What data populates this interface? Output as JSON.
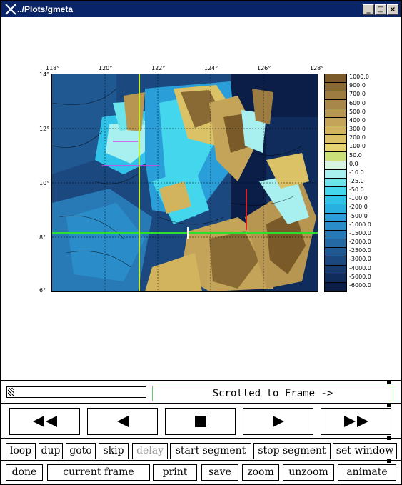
{
  "window": {
    "title": "../Plots/gmeta",
    "min_glyph": "_",
    "max_glyph": "□",
    "close_glyph": "×"
  },
  "map": {
    "x_ticks": [
      "118°",
      "120°",
      "122°",
      "124°",
      "126°",
      "128°"
    ],
    "y_ticks": [
      "14°",
      "12°",
      "10°",
      "8°",
      "6°"
    ],
    "legend": [
      {
        "label": "1000.0",
        "color": "#7a5a28"
      },
      {
        "label": "900.0",
        "color": "#8a6a34"
      },
      {
        "label": "700.0",
        "color": "#9c7c40"
      },
      {
        "label": "600.0",
        "color": "#a8884a"
      },
      {
        "label": "500.0",
        "color": "#b69650"
      },
      {
        "label": "400.0",
        "color": "#c4a458"
      },
      {
        "label": "300.0",
        "color": "#d2b45e"
      },
      {
        "label": "200.0",
        "color": "#dcc266"
      },
      {
        "label": "100.0",
        "color": "#e6d470"
      },
      {
        "label": "50.0",
        "color": "#cce07a"
      },
      {
        "label": "0.0",
        "color": "#d8f4e0"
      },
      {
        "label": "-10.0",
        "color": "#a8f0f0"
      },
      {
        "label": "-25.0",
        "color": "#6ce4ec"
      },
      {
        "label": "-50.0",
        "color": "#44d6ec"
      },
      {
        "label": "-100.0",
        "color": "#30c2e8"
      },
      {
        "label": "-200.0",
        "color": "#28b0e0"
      },
      {
        "label": "-500.0",
        "color": "#2a9ed8"
      },
      {
        "label": "-1000.0",
        "color": "#2a8cc8"
      },
      {
        "label": "-1500.0",
        "color": "#287ab6"
      },
      {
        "label": "-2000.0",
        "color": "#2468a4"
      },
      {
        "label": "-2500.0",
        "color": "#205892"
      },
      {
        "label": "-3000.0",
        "color": "#1c4880"
      },
      {
        "label": "-4000.0",
        "color": "#163a6e"
      },
      {
        "label": "-5000.0",
        "color": "#102c5c"
      },
      {
        "label": "-6000.0",
        "color": "#0a1e48"
      }
    ]
  },
  "scroll": {
    "status_text": "Scrolled to Frame ->"
  },
  "nav": {
    "fast_back": "◀◀",
    "back": "◀",
    "stop": "■",
    "forward": "▶",
    "fast_forward": "▶▶"
  },
  "options": {
    "loop": "loop",
    "dup": "dup",
    "goto": "goto",
    "skip": "skip",
    "delay": "delay",
    "start_segment": "start segment",
    "stop_segment": "stop segment",
    "set_window": "set window"
  },
  "actions": {
    "done": "done",
    "current_frame": "current frame",
    "print": "print",
    "save": "save",
    "zoom": "zoom",
    "unzoom": "unzoom",
    "animate": "animate"
  }
}
